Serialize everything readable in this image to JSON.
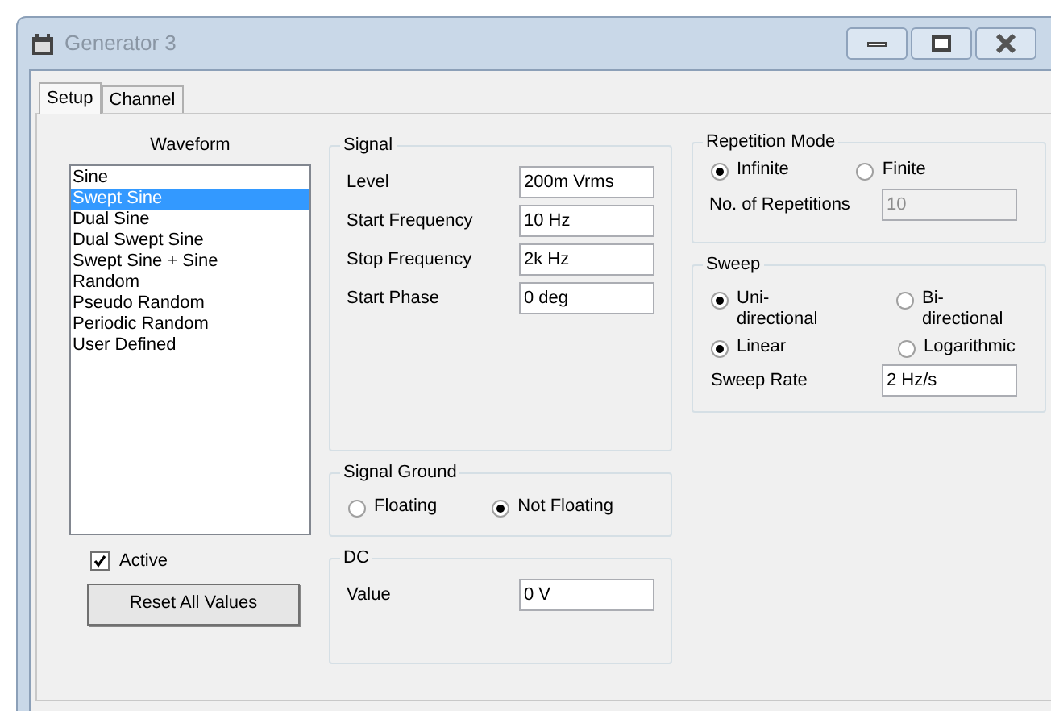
{
  "window": {
    "title": "Generator 3"
  },
  "tabs": [
    {
      "label": "Setup",
      "selected": true
    },
    {
      "label": "Channel",
      "selected": false
    }
  ],
  "waveform": {
    "title": "Waveform",
    "items": [
      {
        "label": "Sine",
        "selected": false
      },
      {
        "label": "Swept Sine",
        "selected": true
      },
      {
        "label": "Dual Sine",
        "selected": false
      },
      {
        "label": "Dual Swept Sine",
        "selected": false
      },
      {
        "label": "Swept Sine + Sine",
        "selected": false
      },
      {
        "label": "Random",
        "selected": false
      },
      {
        "label": "Pseudo Random",
        "selected": false
      },
      {
        "label": "Periodic Random",
        "selected": false
      },
      {
        "label": "User Defined",
        "selected": false
      }
    ],
    "active": {
      "label": "Active",
      "checked": true
    },
    "reset_button": "Reset All Values"
  },
  "signal": {
    "title": "Signal",
    "fields": [
      {
        "label": "Level",
        "value": "200m Vrms"
      },
      {
        "label": "Start Frequency",
        "value": "10 Hz"
      },
      {
        "label": "Stop Frequency",
        "value": "2k Hz"
      },
      {
        "label": "Start Phase",
        "value": "0 deg"
      }
    ]
  },
  "signal_ground": {
    "title": "Signal Ground",
    "options": [
      {
        "label": "Floating",
        "selected": false
      },
      {
        "label": "Not Floating",
        "selected": true
      }
    ]
  },
  "dc": {
    "title": "DC",
    "fields": [
      {
        "label": "Value",
        "value": "0 V"
      }
    ]
  },
  "repetition_mode": {
    "title": "Repetition Mode",
    "options": [
      {
        "label": "Infinite",
        "selected": true
      },
      {
        "label": "Finite",
        "selected": false
      }
    ],
    "repetitions": {
      "label": "No. of Repetitions",
      "value": "10",
      "disabled": true
    }
  },
  "sweep": {
    "title": "Sweep",
    "direction": [
      {
        "label": "Uni-directional",
        "selected": true
      },
      {
        "label": "Bi-directional",
        "selected": false
      }
    ],
    "scale": [
      {
        "label": "Linear",
        "selected": true
      },
      {
        "label": "Logarithmic",
        "selected": false
      }
    ],
    "rate": {
      "label": "Sweep Rate",
      "value": "2 Hz/s"
    }
  }
}
